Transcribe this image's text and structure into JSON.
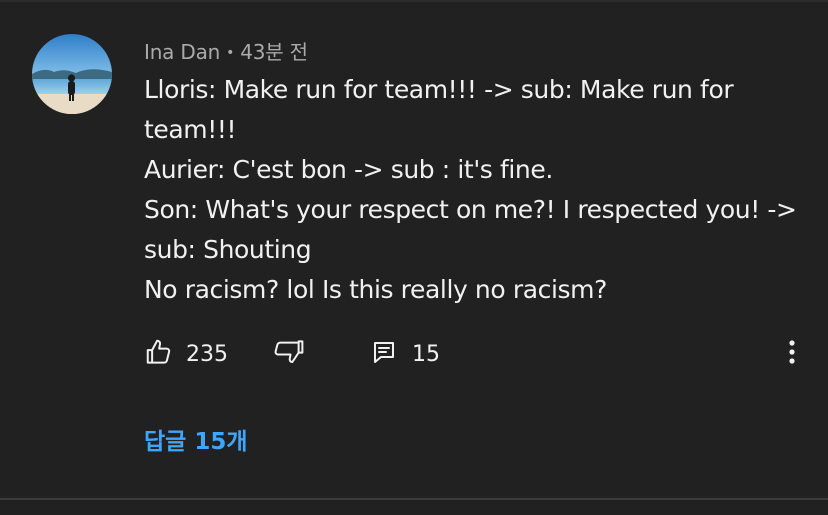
{
  "comment": {
    "author": "Ina Dan",
    "separator": "•",
    "time": "43분 전",
    "lines": [
      "Lloris: Make run for team!!! -> sub: Make run for",
      "team!!!",
      "Aurier: C'est bon -> sub : it's fine.",
      "Son: What's your respect on me?! I respected you! ->",
      "sub: Shouting",
      "No racism? lol Is this really no racism?"
    ],
    "likes": "235",
    "replies_count": "15",
    "replies_link": "답글 15개"
  },
  "icons": {
    "like": "thumbs-up-icon",
    "dislike": "thumbs-down-icon",
    "reply": "comment-icon",
    "more": "more-vert-icon"
  },
  "colors": {
    "background": "#212121",
    "text": "#f1f1f1",
    "meta_text": "#aaaaaa",
    "link": "#3ea6ff"
  }
}
